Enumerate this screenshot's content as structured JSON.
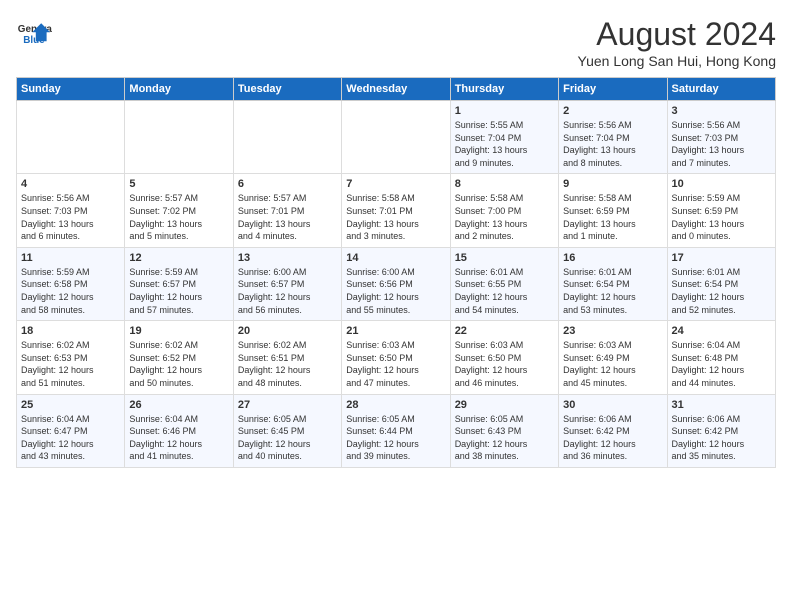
{
  "header": {
    "logo_line1": "General",
    "logo_line2": "Blue",
    "month_year": "August 2024",
    "location": "Yuen Long San Hui, Hong Kong"
  },
  "weekdays": [
    "Sunday",
    "Monday",
    "Tuesday",
    "Wednesday",
    "Thursday",
    "Friday",
    "Saturday"
  ],
  "weeks": [
    [
      {
        "day": "",
        "info": ""
      },
      {
        "day": "",
        "info": ""
      },
      {
        "day": "",
        "info": ""
      },
      {
        "day": "",
        "info": ""
      },
      {
        "day": "1",
        "info": "Sunrise: 5:55 AM\nSunset: 7:04 PM\nDaylight: 13 hours\nand 9 minutes."
      },
      {
        "day": "2",
        "info": "Sunrise: 5:56 AM\nSunset: 7:04 PM\nDaylight: 13 hours\nand 8 minutes."
      },
      {
        "day": "3",
        "info": "Sunrise: 5:56 AM\nSunset: 7:03 PM\nDaylight: 13 hours\nand 7 minutes."
      }
    ],
    [
      {
        "day": "4",
        "info": "Sunrise: 5:56 AM\nSunset: 7:03 PM\nDaylight: 13 hours\nand 6 minutes."
      },
      {
        "day": "5",
        "info": "Sunrise: 5:57 AM\nSunset: 7:02 PM\nDaylight: 13 hours\nand 5 minutes."
      },
      {
        "day": "6",
        "info": "Sunrise: 5:57 AM\nSunset: 7:01 PM\nDaylight: 13 hours\nand 4 minutes."
      },
      {
        "day": "7",
        "info": "Sunrise: 5:58 AM\nSunset: 7:01 PM\nDaylight: 13 hours\nand 3 minutes."
      },
      {
        "day": "8",
        "info": "Sunrise: 5:58 AM\nSunset: 7:00 PM\nDaylight: 13 hours\nand 2 minutes."
      },
      {
        "day": "9",
        "info": "Sunrise: 5:58 AM\nSunset: 6:59 PM\nDaylight: 13 hours\nand 1 minute."
      },
      {
        "day": "10",
        "info": "Sunrise: 5:59 AM\nSunset: 6:59 PM\nDaylight: 13 hours\nand 0 minutes."
      }
    ],
    [
      {
        "day": "11",
        "info": "Sunrise: 5:59 AM\nSunset: 6:58 PM\nDaylight: 12 hours\nand 58 minutes."
      },
      {
        "day": "12",
        "info": "Sunrise: 5:59 AM\nSunset: 6:57 PM\nDaylight: 12 hours\nand 57 minutes."
      },
      {
        "day": "13",
        "info": "Sunrise: 6:00 AM\nSunset: 6:57 PM\nDaylight: 12 hours\nand 56 minutes."
      },
      {
        "day": "14",
        "info": "Sunrise: 6:00 AM\nSunset: 6:56 PM\nDaylight: 12 hours\nand 55 minutes."
      },
      {
        "day": "15",
        "info": "Sunrise: 6:01 AM\nSunset: 6:55 PM\nDaylight: 12 hours\nand 54 minutes."
      },
      {
        "day": "16",
        "info": "Sunrise: 6:01 AM\nSunset: 6:54 PM\nDaylight: 12 hours\nand 53 minutes."
      },
      {
        "day": "17",
        "info": "Sunrise: 6:01 AM\nSunset: 6:54 PM\nDaylight: 12 hours\nand 52 minutes."
      }
    ],
    [
      {
        "day": "18",
        "info": "Sunrise: 6:02 AM\nSunset: 6:53 PM\nDaylight: 12 hours\nand 51 minutes."
      },
      {
        "day": "19",
        "info": "Sunrise: 6:02 AM\nSunset: 6:52 PM\nDaylight: 12 hours\nand 50 minutes."
      },
      {
        "day": "20",
        "info": "Sunrise: 6:02 AM\nSunset: 6:51 PM\nDaylight: 12 hours\nand 48 minutes."
      },
      {
        "day": "21",
        "info": "Sunrise: 6:03 AM\nSunset: 6:50 PM\nDaylight: 12 hours\nand 47 minutes."
      },
      {
        "day": "22",
        "info": "Sunrise: 6:03 AM\nSunset: 6:50 PM\nDaylight: 12 hours\nand 46 minutes."
      },
      {
        "day": "23",
        "info": "Sunrise: 6:03 AM\nSunset: 6:49 PM\nDaylight: 12 hours\nand 45 minutes."
      },
      {
        "day": "24",
        "info": "Sunrise: 6:04 AM\nSunset: 6:48 PM\nDaylight: 12 hours\nand 44 minutes."
      }
    ],
    [
      {
        "day": "25",
        "info": "Sunrise: 6:04 AM\nSunset: 6:47 PM\nDaylight: 12 hours\nand 43 minutes."
      },
      {
        "day": "26",
        "info": "Sunrise: 6:04 AM\nSunset: 6:46 PM\nDaylight: 12 hours\nand 41 minutes."
      },
      {
        "day": "27",
        "info": "Sunrise: 6:05 AM\nSunset: 6:45 PM\nDaylight: 12 hours\nand 40 minutes."
      },
      {
        "day": "28",
        "info": "Sunrise: 6:05 AM\nSunset: 6:44 PM\nDaylight: 12 hours\nand 39 minutes."
      },
      {
        "day": "29",
        "info": "Sunrise: 6:05 AM\nSunset: 6:43 PM\nDaylight: 12 hours\nand 38 minutes."
      },
      {
        "day": "30",
        "info": "Sunrise: 6:06 AM\nSunset: 6:42 PM\nDaylight: 12 hours\nand 36 minutes."
      },
      {
        "day": "31",
        "info": "Sunrise: 6:06 AM\nSunset: 6:42 PM\nDaylight: 12 hours\nand 35 minutes."
      }
    ]
  ]
}
